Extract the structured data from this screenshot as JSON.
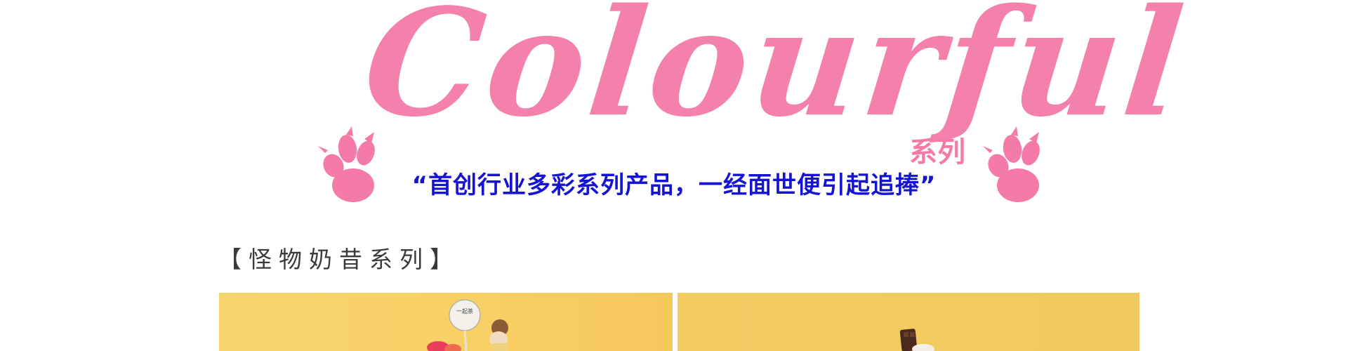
{
  "theme": {
    "pink": "#f47aa8",
    "blue": "#1414d2",
    "yellow": "#f7d164"
  },
  "hero": {
    "title": "Colourful",
    "title_suffix": "系列",
    "tagline": "“首创行业多彩系列产品，一经面世便引起追捧”",
    "decorations": [
      "paw-print-icon",
      "paw-print-icon"
    ]
  },
  "section": {
    "title": "【怪物奶昔系列】"
  },
  "products": [
    {
      "image": "monster-milkshake-photo",
      "tag_text": "一起茶"
    },
    {
      "image": "chocolate-milkshake-photo"
    }
  ]
}
